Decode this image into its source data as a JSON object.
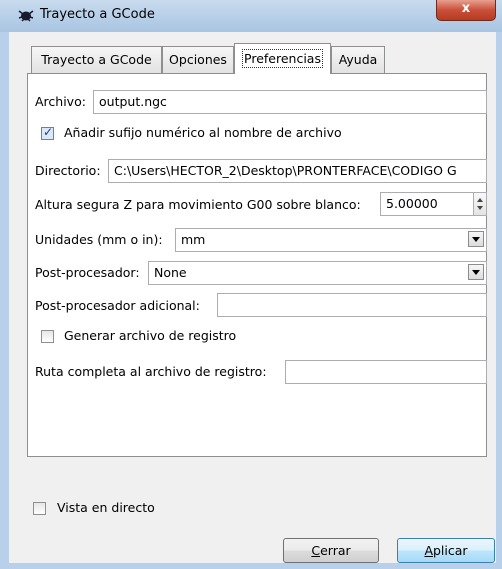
{
  "window": {
    "title": "Trayecto a GCode",
    "close_label": "x"
  },
  "tabs": [
    {
      "label": "Trayecto a GCode"
    },
    {
      "label": "Opciones"
    },
    {
      "label": "Preferencias"
    },
    {
      "label": "Ayuda"
    }
  ],
  "preferences": {
    "archivo_label": "Archivo:",
    "archivo_value": "output.ngc",
    "sufijo_label": "Añadir sufijo numérico al nombre de archivo",
    "sufijo_checked": true,
    "directorio_label": "Directorio:",
    "directorio_value": "C:\\Users\\HECTOR_2\\Desktop\\PRONTERFACE\\CODIGO G",
    "altura_label": "Altura segura Z para movimiento G00 sobre blanco:",
    "altura_value": "5.00000",
    "unidades_label": "Unidades (mm o in):",
    "unidades_value": "mm",
    "postproc_label": "Post-procesador:",
    "postproc_value": "None",
    "postproc_adicional_label": "Post-procesador adicional:",
    "postproc_adicional_value": "",
    "registro_label": "Generar archivo de registro",
    "registro_checked": false,
    "ruta_label": "Ruta completa al archivo de registro:",
    "ruta_value": ""
  },
  "footer": {
    "vista_label": "Vista en directo",
    "vista_checked": false,
    "cerrar_accel": "C",
    "cerrar_rest": "errar",
    "aplicar_accel": "A",
    "aplicar_rest": "plicar"
  }
}
